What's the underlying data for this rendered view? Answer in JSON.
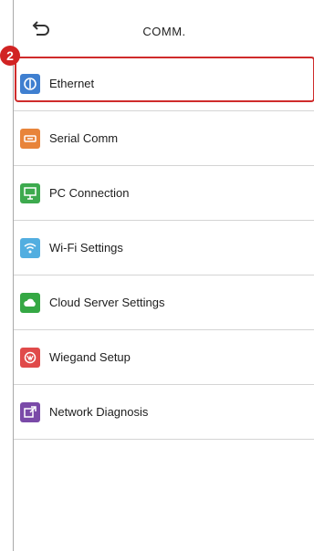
{
  "header": {
    "title": "COMM.",
    "back_icon": "back-return-icon"
  },
  "step_badge": "2",
  "menu": {
    "items": [
      {
        "label": "Ethernet",
        "icon": "ethernet-icon",
        "color": "#3f7fd0",
        "selected": true
      },
      {
        "label": "Serial Comm",
        "icon": "serial-comm-icon",
        "color": "#e8843a",
        "selected": false
      },
      {
        "label": "PC Connection",
        "icon": "pc-connection-icon",
        "color": "#3daa4e",
        "selected": false
      },
      {
        "label": "Wi-Fi Settings",
        "icon": "wifi-icon",
        "color": "#52aee0",
        "selected": false
      },
      {
        "label": "Cloud Server Settings",
        "icon": "cloud-icon",
        "color": "#35a844",
        "selected": false
      },
      {
        "label": "Wiegand Setup",
        "icon": "wiegand-icon",
        "color": "#e04a4a",
        "selected": false
      },
      {
        "label": "Network Diagnosis",
        "icon": "network-diagnosis-icon",
        "color": "#7a4aa8",
        "selected": false
      }
    ]
  },
  "colors": {
    "highlight": "#cf2b2b",
    "badge": "#d12323",
    "divider": "#d4d4d4"
  }
}
